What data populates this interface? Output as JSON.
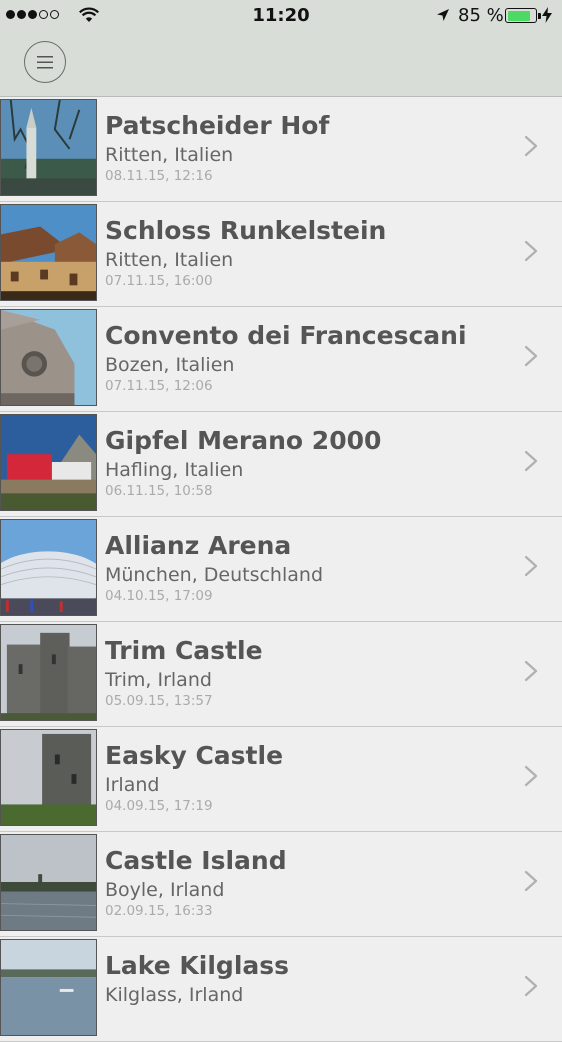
{
  "status_bar": {
    "time": "11:20",
    "battery_percent": "85 %",
    "battery_level": 0.85,
    "signal_bars": 3,
    "signal_total": 5,
    "icons": [
      "wifi-icon",
      "location-arrow-icon",
      "battery-icon",
      "charging-bolt-icon"
    ]
  },
  "nav": {
    "menu_icon": "hamburger-menu-icon"
  },
  "colors": {
    "background": "#efefef",
    "bar": "#d8ddd8",
    "battery_fill": "#4cd964",
    "title": "#555555",
    "date": "#aaaaaa"
  },
  "places": [
    {
      "title": "Patscheider Hof",
      "location": "Ritten, Italien",
      "date": "08.11.15, 12:16",
      "thumb": "tree-church-photo"
    },
    {
      "title": "Schloss Runkelstein",
      "location": "Ritten, Italien",
      "date": "07.11.15, 16:00",
      "thumb": "castle-roofs-photo"
    },
    {
      "title": "Convento dei Francescani",
      "location": "Bozen, Italien",
      "date": "07.11.15, 12:06",
      "thumb": "church-rose-window-photo"
    },
    {
      "title": "Gipfel Merano 2000",
      "location": "Hafling, Italien",
      "date": "06.11.15, 10:58",
      "thumb": "mountain-station-photo"
    },
    {
      "title": "Allianz Arena",
      "location": "München, Deutschland",
      "date": "04.10.15, 17:09",
      "thumb": "stadium-photo"
    },
    {
      "title": "Trim Castle",
      "location": "Trim, Irland",
      "date": "05.09.15, 13:57",
      "thumb": "stone-castle-photo"
    },
    {
      "title": " Easky Castle",
      "location": "Irland",
      "date": "04.09.15, 17:19",
      "thumb": "tower-ruin-photo"
    },
    {
      "title": "Castle Island",
      "location": "Boyle, Irland",
      "date": "02.09.15, 16:33",
      "thumb": "lake-island-photo"
    },
    {
      "title": "Lake Kilglass",
      "location": "Kilglass, Irland",
      "date": "",
      "thumb": "lake-photo"
    }
  ]
}
